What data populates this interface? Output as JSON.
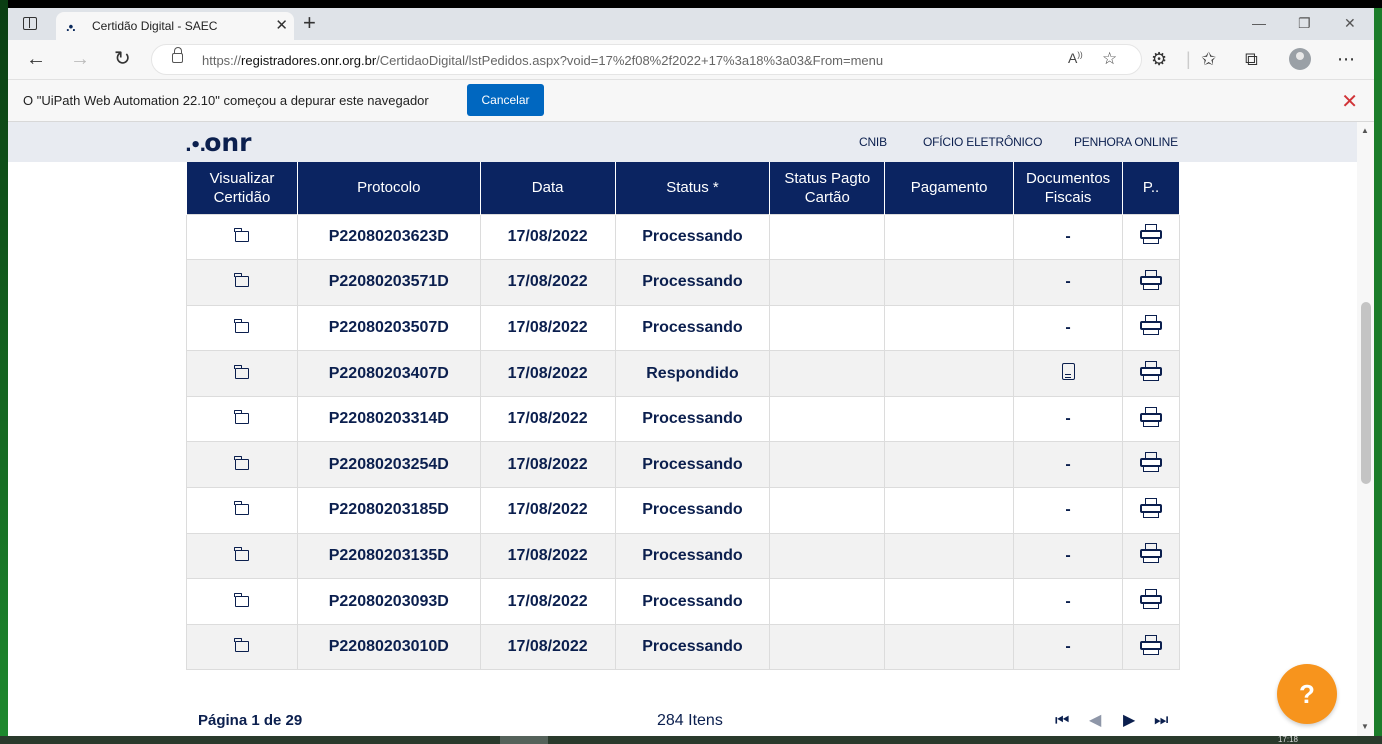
{
  "browser": {
    "tab_title": "Certidão Digital - SAEC",
    "tab_favicon": ".•.",
    "url_prefix": "https://",
    "url_host": "registradores.onr.org.br",
    "url_path": "/CertidaoDigital/lstPedidos.aspx?void=17%2f08%2f2022+17%3a18%3a03&From=menu",
    "new_tab": "+",
    "tab_close": "✕",
    "minimize": "—",
    "restore": "❐",
    "close": "✕"
  },
  "infobar": {
    "message": "O \"UiPath Web Automation 22.10\" começou a depurar este navegador",
    "cancel_label": "Cancelar",
    "close_symbol": "✕"
  },
  "site": {
    "logo_dots": ".•.",
    "logo_text": "onr",
    "nav": [
      "CNIB",
      "OFÍCIO ELETRÔNICO",
      "PENHORA ONLINE"
    ]
  },
  "table": {
    "headers": {
      "visualizar_1": "Visualizar",
      "visualizar_2": "Certidão",
      "protocolo": "Protocolo",
      "data": "Data",
      "status": "Status *",
      "status_pagto_1": "Status Pagto",
      "status_pagto_2": "Cartão",
      "pagamento": "Pagamento",
      "documentos_1": "Documentos",
      "documentos_2": "Fiscais",
      "print": "P.."
    },
    "rows": [
      {
        "protocolo": "P22080203623D",
        "data": "17/08/2022",
        "status": "Processando",
        "status_pagto": "",
        "pagamento": "",
        "documentos": "-"
      },
      {
        "protocolo": "P22080203571D",
        "data": "17/08/2022",
        "status": "Processando",
        "status_pagto": "",
        "pagamento": "",
        "documentos": "-"
      },
      {
        "protocolo": "P22080203507D",
        "data": "17/08/2022",
        "status": "Processando",
        "status_pagto": "",
        "pagamento": "",
        "documentos": "-"
      },
      {
        "protocolo": "P22080203407D",
        "data": "17/08/2022",
        "status": "Respondido",
        "status_pagto": "",
        "pagamento": "",
        "documentos": "doc-icon"
      },
      {
        "protocolo": "P22080203314D",
        "data": "17/08/2022",
        "status": "Processando",
        "status_pagto": "",
        "pagamento": "",
        "documentos": "-"
      },
      {
        "protocolo": "P22080203254D",
        "data": "17/08/2022",
        "status": "Processando",
        "status_pagto": "",
        "pagamento": "",
        "documentos": "-"
      },
      {
        "protocolo": "P22080203185D",
        "data": "17/08/2022",
        "status": "Processando",
        "status_pagto": "",
        "pagamento": "",
        "documentos": "-"
      },
      {
        "protocolo": "P22080203135D",
        "data": "17/08/2022",
        "status": "Processando",
        "status_pagto": "",
        "pagamento": "",
        "documentos": "-"
      },
      {
        "protocolo": "P22080203093D",
        "data": "17/08/2022",
        "status": "Processando",
        "status_pagto": "",
        "pagamento": "",
        "documentos": "-"
      },
      {
        "protocolo": "P22080203010D",
        "data": "17/08/2022",
        "status": "Processando",
        "status_pagto": "",
        "pagamento": "",
        "documentos": "-"
      }
    ]
  },
  "pager": {
    "page_info": "Página 1 de  29",
    "item_count": "284 Itens",
    "first": "⏮",
    "prev": "◀",
    "next": "▶",
    "last": "⏭"
  },
  "help_fab": "?",
  "colors": {
    "navy": "#0b2461",
    "orange": "#f7941d",
    "edge_blue": "#0067c0"
  },
  "taskbar_clock": "17:18"
}
